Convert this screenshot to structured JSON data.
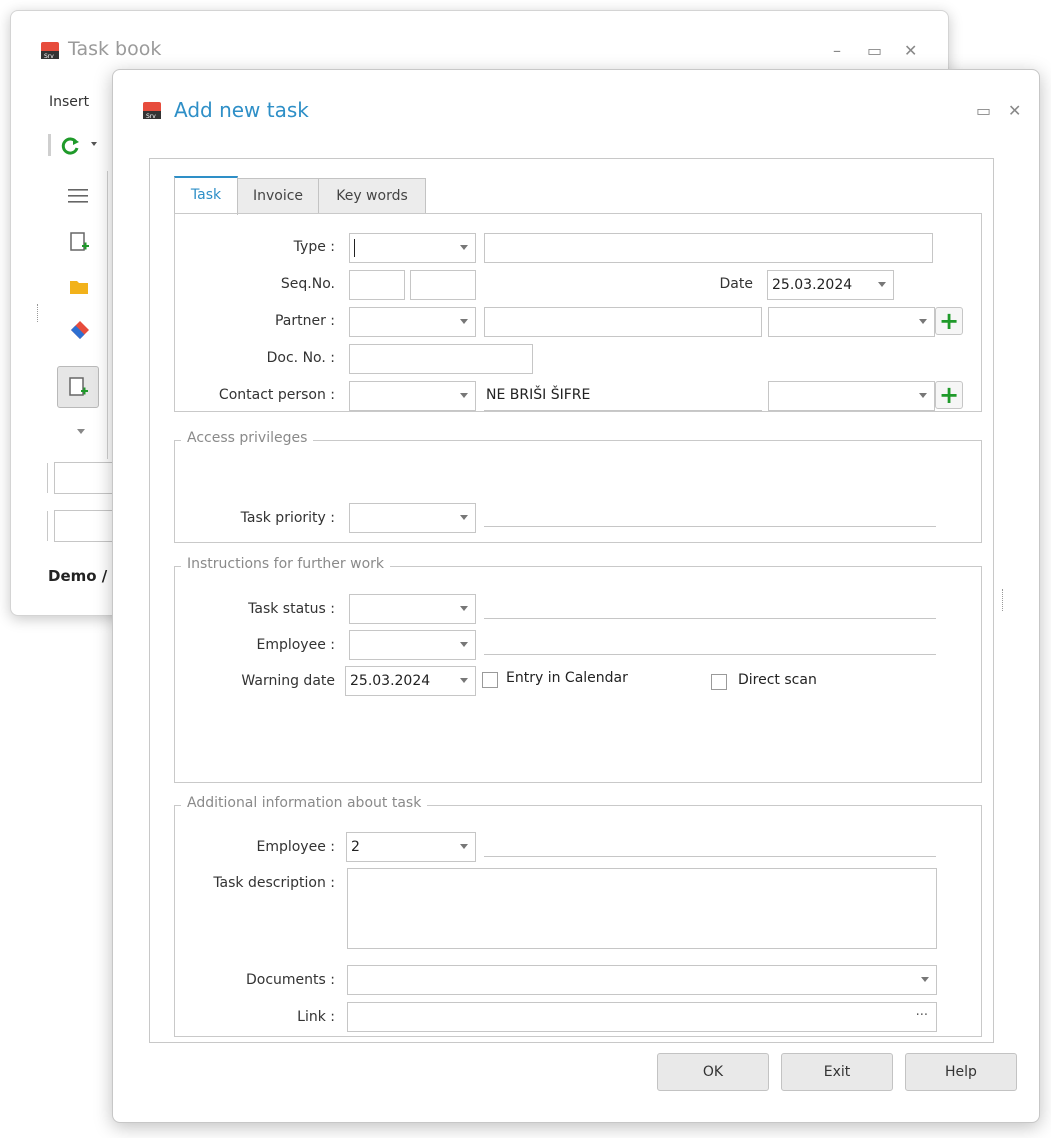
{
  "background_window": {
    "title": "Task book",
    "menu_insert": "Insert",
    "status_text": "Demo /",
    "controls": {
      "minimize": "–",
      "maximize": "▭",
      "close": "✕"
    }
  },
  "dialog": {
    "title": "Add new task",
    "controls": {
      "maximize": "▭",
      "close": "✕"
    },
    "tabs": [
      "Task",
      "Invoice",
      "Key words"
    ],
    "task": {
      "type_label": "Type :",
      "type_value": "",
      "type_desc": "",
      "seqno_label": "Seq.No.",
      "seqno_a": "",
      "seqno_b": "",
      "date_label": "Date",
      "date_value": "25.03.2024",
      "partner_label": "Partner :",
      "partner_value": "",
      "partner_name": "",
      "partner_extra": "",
      "docno_label": "Doc. No. :",
      "docno_value": "",
      "contact_label": "Contact person :",
      "contact_value": "",
      "contact_desc": "NE BRIŠI ŠIFRE",
      "contact_extra": ""
    },
    "access": {
      "legend": "Access privileges",
      "priority_label": "Task priority :",
      "priority_value": ""
    },
    "instructions": {
      "legend": "Instructions for further work",
      "status_label": "Task status :",
      "status_value": "",
      "employee_label": "Employee :",
      "employee_value": "",
      "warning_label": "Warning date",
      "warning_value": "25.03.2024",
      "entry_calendar_label": "Entry in Calendar",
      "entry_calendar_checked": false,
      "direct_scan_label": "Direct scan",
      "direct_scan_checked": false
    },
    "additional": {
      "legend": "Additional information about task",
      "employee_label": "Employee :",
      "employee_value": "2",
      "description_label": "Task description :",
      "description_value": "",
      "documents_label": "Documents :",
      "documents_value": "",
      "link_label": "Link :",
      "link_value": "",
      "link_button": "···"
    },
    "buttons": {
      "ok": "OK",
      "exit": "Exit",
      "help": "Help"
    }
  },
  "colors": {
    "accent": "#2e8fc7",
    "plus_green": "#1f9a2a"
  }
}
